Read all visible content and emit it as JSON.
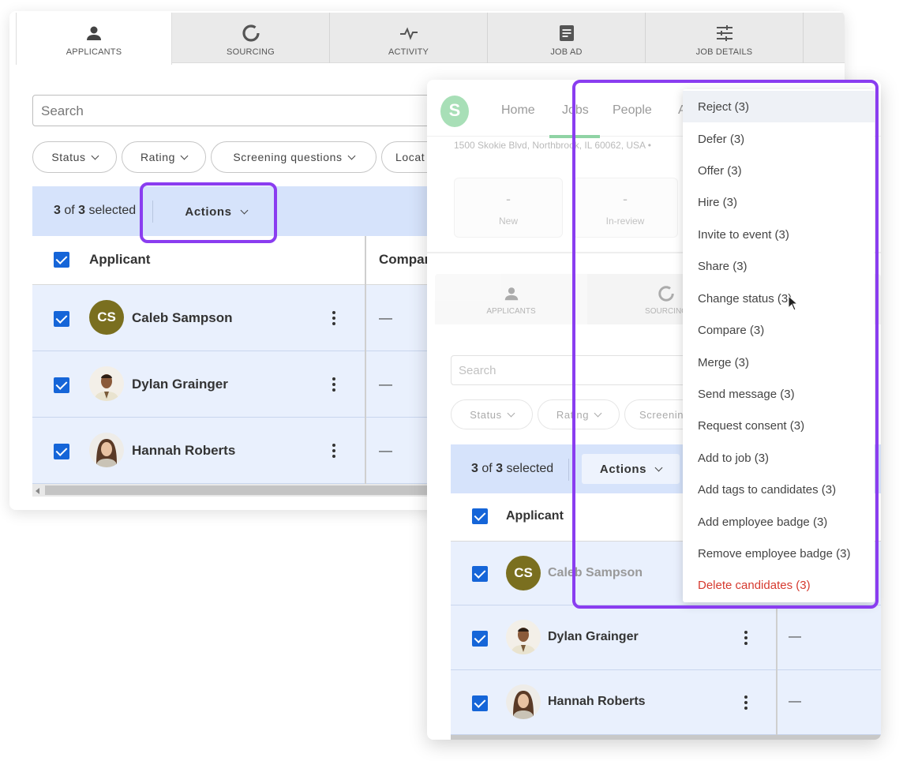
{
  "tabs": [
    {
      "label": "APPLICANTS",
      "icon": "person-icon"
    },
    {
      "label": "SOURCING",
      "icon": "ring-icon"
    },
    {
      "label": "ACTIVITY",
      "icon": "pulse-icon"
    },
    {
      "label": "JOB AD",
      "icon": "document-icon"
    },
    {
      "label": "JOB DETAILS",
      "icon": "sliders-icon"
    }
  ],
  "search_placeholder": "Search",
  "filters": [
    "Status",
    "Rating",
    "Screening questions",
    "Locat"
  ],
  "selection": {
    "count": "3",
    "of": "of",
    "total": "3",
    "suffix": "selected"
  },
  "actions_label": "Actions",
  "columns": {
    "applicant": "Applicant",
    "company": "Compan"
  },
  "applicants": [
    {
      "name": "Caleb Sampson",
      "initials": "CS",
      "company": "—"
    },
    {
      "name": "Dylan Grainger",
      "initials": "",
      "company": "—"
    },
    {
      "name": "Hannah Roberts",
      "initials": "",
      "company": "—"
    }
  ],
  "app_nav": {
    "logo_letter": "S",
    "items": [
      "Home",
      "Jobs",
      "People",
      "A"
    ],
    "address": "1500 Skokie Blvd, Northbrook, IL 60062, USA •"
  },
  "stats": [
    {
      "value": "-",
      "label": "New"
    },
    {
      "value": "-",
      "label": "In-review"
    }
  ],
  "front_tabs": [
    "APPLICANTS",
    "SOURCING"
  ],
  "front_filters": [
    "Status",
    "Rating",
    "Screenin"
  ],
  "actions_menu": [
    "Reject (3)",
    "Defer (3)",
    "Offer (3)",
    "Hire (3)",
    "Invite to event (3)",
    "Share (3)",
    "Change status (3)",
    "Compare (3)",
    "Merge (3)",
    "Send message (3)",
    "Request consent (3)",
    "Add to job (3)",
    "Add tags to candidates (3)",
    "Add employee badge (3)",
    "Remove employee badge (3)",
    "Delete candidates (3)"
  ],
  "colors": {
    "accent": "#1565d8",
    "highlight": "#8a3df0",
    "danger": "#d63a2f",
    "selection_bg": "#d6e3fb"
  }
}
